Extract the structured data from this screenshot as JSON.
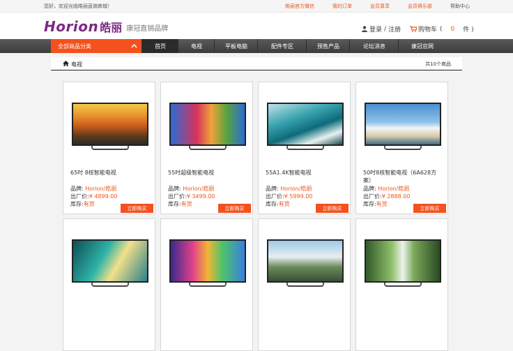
{
  "topbar": {
    "welcome": "您好，欢迎光临皓丽直销商城！",
    "links": [
      "皓丽官方微信",
      "我的订单",
      "会员尊享",
      "会员俱乐部"
    ],
    "help": "帮助中心"
  },
  "header": {
    "logo_en": "Horion",
    "logo_cn": "皓丽",
    "tagline": "康冠直销品牌",
    "login": "登录",
    "separator": "/",
    "register": "注册",
    "cart_label": "购物车",
    "cart_open": "(",
    "cart_count": "0",
    "cart_unit": "件 )"
  },
  "nav": {
    "category_label": "全部商品分类",
    "items": [
      "首页",
      "电视",
      "平板电脑",
      "配件专区",
      "预售产品",
      "论坛消息",
      "康冠官网"
    ]
  },
  "breadcrumb": {
    "current": "电视",
    "total": "共10个商品"
  },
  "labels": {
    "brand": "品牌:",
    "price": "出厂价:",
    "stock": "库存:",
    "buy": "立即购买"
  },
  "products": [
    {
      "title": "65吋 8核智能电视",
      "brand": "Horion/皓丽",
      "price": "¥ 4899.00",
      "stock": "有货"
    },
    {
      "title": "55吋超级智能电视",
      "brand": "Horion/皓丽",
      "price": "¥ 3499.00",
      "stock": "有货"
    },
    {
      "title": "55A1.4K智能电视",
      "brand": "Horion/皓丽",
      "price": "¥ 5999.00",
      "stock": "有货"
    },
    {
      "title": "50吋8核智能电视（6A628方案）",
      "brand": "Horion/皓丽",
      "price": "¥ 2888.00",
      "stock": "有货"
    }
  ],
  "colors": {
    "accent": "#f4511e",
    "brand": "#7b2a83",
    "nav_dark": "#3c3c3c"
  }
}
